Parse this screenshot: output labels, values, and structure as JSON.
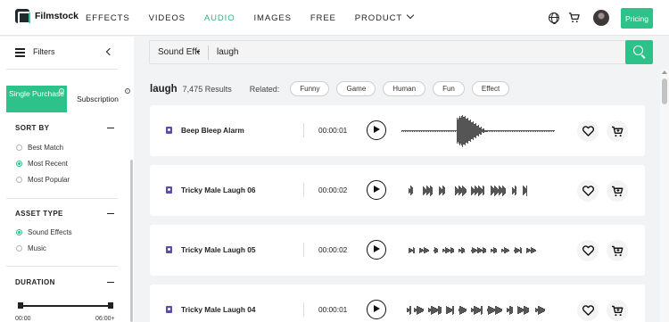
{
  "brand": {
    "name": "Filmstock"
  },
  "nav": {
    "items": [
      "EFFECTS",
      "VIDEOS",
      "AUDIO",
      "IMAGES",
      "FREE",
      "PRODUCT"
    ],
    "active": "AUDIO",
    "pricing_label": "Pricing"
  },
  "sidebar": {
    "filters_label": "Filters",
    "tabs": {
      "single_purchase": "Single Purchase",
      "subscription": "Subscription"
    },
    "sort_by": {
      "title": "SORT BY",
      "options": [
        "Best Match",
        "Most Recent",
        "Most Popular"
      ],
      "selected": "Most Recent"
    },
    "asset_type": {
      "title": "ASSET TYPE",
      "options": [
        "Sound Effects",
        "Music"
      ],
      "selected": "Sound Effects"
    },
    "duration": {
      "title": "DURATION",
      "min_label": "00:00",
      "max_label": "06:00+"
    }
  },
  "search": {
    "type_label": "Sound Effects",
    "query": "laugh"
  },
  "results": {
    "term": "laugh",
    "count": "7,475 Results",
    "related_label": "Related:",
    "related": [
      "Funny",
      "Game",
      "Human",
      "Fun",
      "Effect"
    ]
  },
  "tracks": [
    {
      "title": "Beep Bleep Alarm",
      "duration": "00:00:01"
    },
    {
      "title": "Tricky Male Laugh 06",
      "duration": "00:00:02"
    },
    {
      "title": "Tricky Male Laugh 05",
      "duration": "00:00:02"
    },
    {
      "title": "Tricky Male Laugh 04",
      "duration": "00:00:01"
    }
  ],
  "colors": {
    "accent": "#2cc28a",
    "sfx_badge": "#5c4fa3"
  }
}
